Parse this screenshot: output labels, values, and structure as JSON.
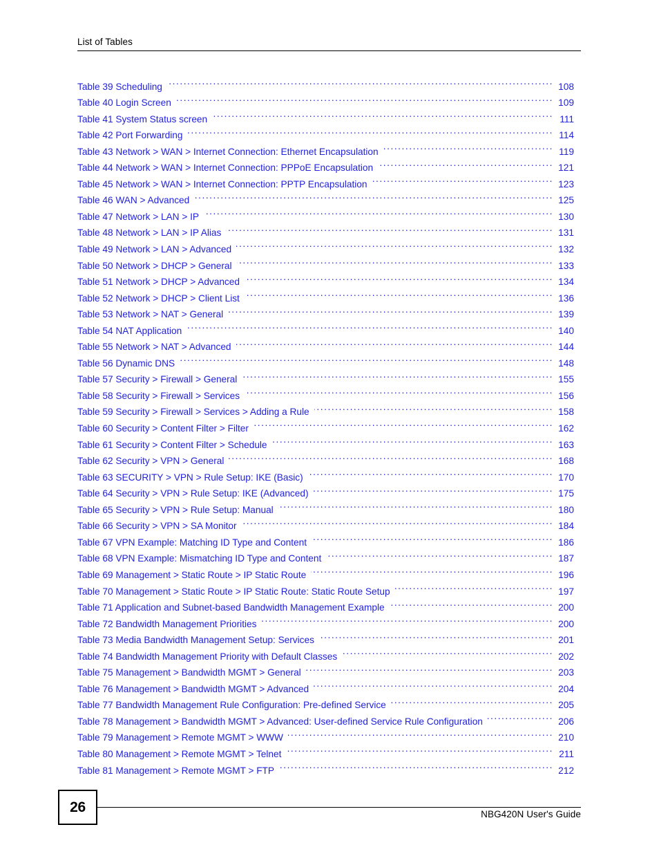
{
  "header": {
    "title": "List of Tables"
  },
  "colors": {
    "link": "#2323dd",
    "text": "#000000",
    "background": "#ffffff"
  },
  "toc": {
    "entries": [
      {
        "label": "Table 39 Scheduling",
        "page": "108"
      },
      {
        "label": "Table 40 Login Screen",
        "page": "109"
      },
      {
        "label": "Table 41 System Status screen",
        "page": "111"
      },
      {
        "label": "Table 42 Port Forwarding",
        "page": "114"
      },
      {
        "label": "Table 43 Network > WAN > Internet Connection: Ethernet Encapsulation",
        "page": "119"
      },
      {
        "label": "Table 44 Network > WAN > Internet Connection: PPPoE Encapsulation",
        "page": "121"
      },
      {
        "label": "Table 45 Network > WAN > Internet Connection: PPTP Encapsulation",
        "page": "123"
      },
      {
        "label": "Table 46 WAN > Advanced",
        "page": "125"
      },
      {
        "label": "Table 47 Network > LAN > IP",
        "page": "130"
      },
      {
        "label": "Table 48 Network > LAN > IP Alias",
        "page": "131"
      },
      {
        "label": "Table 49 Network > LAN > Advanced",
        "page": "132"
      },
      {
        "label": "Table 50 Network > DHCP > General",
        "page": "133"
      },
      {
        "label": "Table 51 Network > DHCP > Advanced",
        "page": "134"
      },
      {
        "label": "Table 52 Network > DHCP > Client List",
        "page": "136"
      },
      {
        "label": "Table 53 Network > NAT > General",
        "page": "139"
      },
      {
        "label": "Table 54 NAT Application",
        "page": "140"
      },
      {
        "label": "Table 55 Network > NAT > Advanced",
        "page": "144"
      },
      {
        "label": "Table 56 Dynamic DNS",
        "page": "148"
      },
      {
        "label": "Table 57 Security > Firewall > General",
        "page": "155"
      },
      {
        "label": "Table 58 Security > Firewall > Services",
        "page": "156"
      },
      {
        "label": "Table 59 Security > Firewall > Services > Adding a Rule",
        "page": "158"
      },
      {
        "label": "Table 60 Security > Content Filter > Filter",
        "page": "162"
      },
      {
        "label": "Table 61 Security > Content Filter > Schedule",
        "page": "163"
      },
      {
        "label": "Table 62 Security > VPN > General",
        "page": "168"
      },
      {
        "label": "Table 63 SECURITY > VPN > Rule Setup: IKE (Basic)",
        "page": "170"
      },
      {
        "label": "Table 64 Security > VPN > Rule Setup: IKE (Advanced)",
        "page": "175"
      },
      {
        "label": "Table 65 Security > VPN > Rule Setup: Manual",
        "page": "180"
      },
      {
        "label": "Table 66 Security > VPN > SA Monitor",
        "page": "184"
      },
      {
        "label": "Table 67 VPN Example: Matching ID Type and Content",
        "page": "186"
      },
      {
        "label": "Table 68 VPN Example: Mismatching ID Type and Content",
        "page": "187"
      },
      {
        "label": "Table 69 Management > Static Route > IP Static Route",
        "page": "196"
      },
      {
        "label": "Table 70 Management > Static Route > IP Static Route: Static Route Setup",
        "page": "197"
      },
      {
        "label": "Table 71 Application and Subnet-based Bandwidth Management Example",
        "page": "200"
      },
      {
        "label": "Table 72 Bandwidth Management Priorities",
        "page": "200"
      },
      {
        "label": "Table 73 Media Bandwidth Management Setup: Services",
        "page": "201"
      },
      {
        "label": "Table 74 Bandwidth Management Priority with Default Classes",
        "page": "202"
      },
      {
        "label": "Table 75 Management > Bandwidth MGMT > General",
        "page": "203"
      },
      {
        "label": "Table 76 Management > Bandwidth MGMT > Advanced",
        "page": "204"
      },
      {
        "label": "Table 77 Bandwidth Management Rule Configuration: Pre-defined Service",
        "page": "205"
      },
      {
        "label": "Table 78 Management > Bandwidth MGMT > Advanced: User-defined Service Rule Configuration",
        "page": "206"
      },
      {
        "label": "Table 79 Management > Remote MGMT > WWW",
        "page": "210"
      },
      {
        "label": "Table 80 Management > Remote MGMT > Telnet",
        "page": "211"
      },
      {
        "label": "Table 81 Management > Remote MGMT > FTP",
        "page": "212"
      }
    ]
  },
  "footer": {
    "page_number": "26",
    "document_title": "NBG420N User's Guide"
  }
}
